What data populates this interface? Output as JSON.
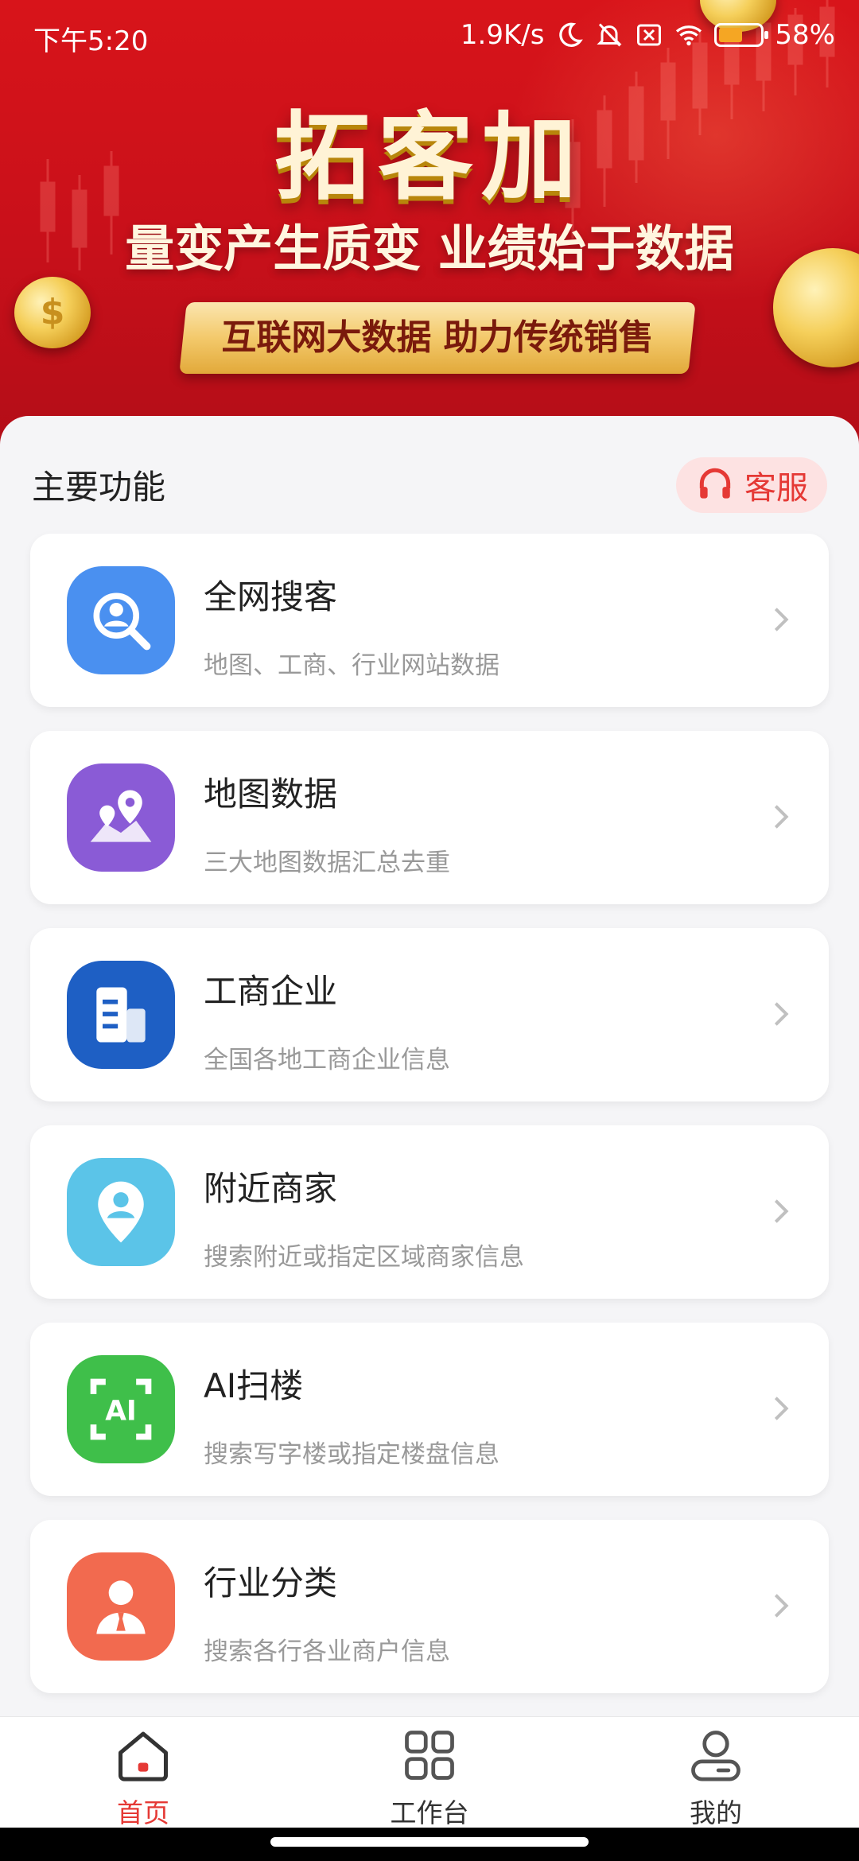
{
  "status_bar": {
    "time": "下午5:20",
    "speed": "1.9K/s",
    "battery": "58%",
    "battery_level": 0.58
  },
  "banner": {
    "title": "拓客加",
    "slogan": "量变产生质变 业绩始于数据",
    "ribbon": "互联网大数据 助力传统销售"
  },
  "main": {
    "section_title": "主要功能",
    "service_label": "客服",
    "features": [
      {
        "title": "全网搜客",
        "desc": "地图、工商、行业网站数据",
        "icon": "search-user-icon",
        "color": "#4a90f0"
      },
      {
        "title": "地图数据",
        "desc": "三大地图数据汇总去重",
        "icon": "map-pin-icon",
        "color": "#8a5bd6"
      },
      {
        "title": "工商企业",
        "desc": "全国各地工商企业信息",
        "icon": "building-icon",
        "color": "#1e5fc4"
      },
      {
        "title": "附近商家",
        "desc": "搜索附近或指定区域商家信息",
        "icon": "location-person-icon",
        "color": "#5bc4e8"
      },
      {
        "title": "AI扫楼",
        "desc": "搜索写字楼或指定楼盘信息",
        "icon": "ai-scan-icon",
        "color": "#3fbf4a"
      },
      {
        "title": "行业分类",
        "desc": "搜索各行各业商户信息",
        "icon": "business-person-icon",
        "color": "#f26a4f"
      }
    ]
  },
  "tabbar": {
    "tabs": [
      {
        "label": "首页",
        "icon": "home-icon",
        "active": true
      },
      {
        "label": "工作台",
        "icon": "grid-icon",
        "active": false
      },
      {
        "label": "我的",
        "icon": "profile-icon",
        "active": false
      }
    ],
    "active_color": "#e53935"
  }
}
